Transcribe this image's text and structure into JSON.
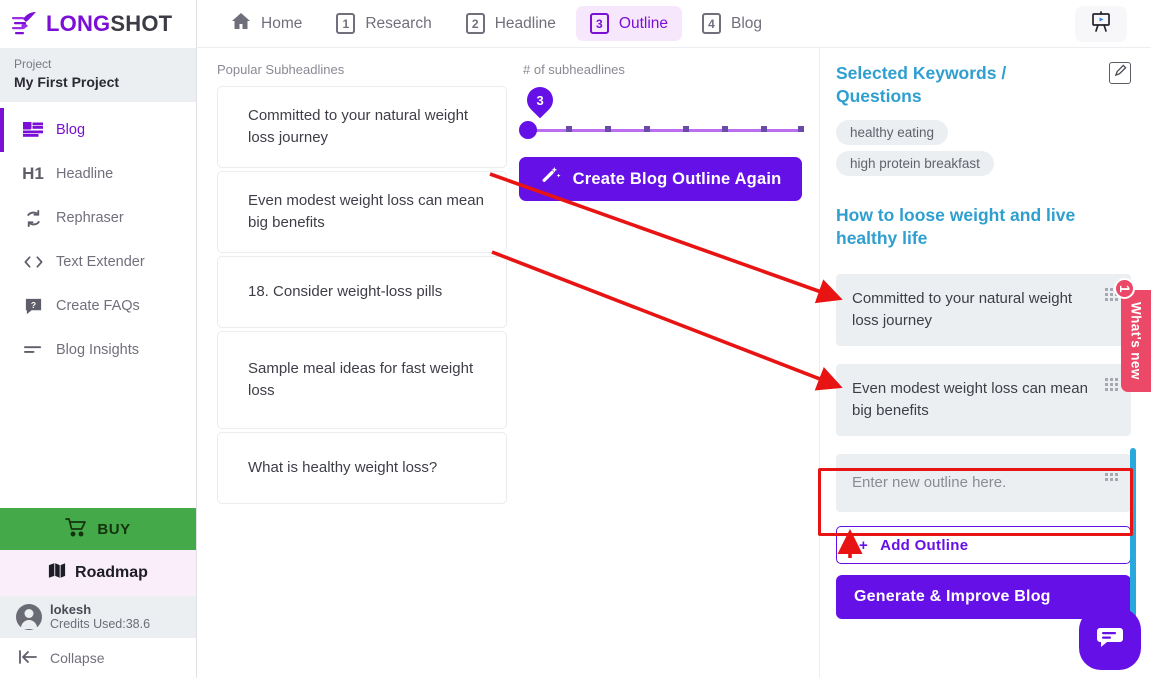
{
  "brand": {
    "logo_long": "LONG",
    "logo_shot": "SHOT",
    "logo_icon": "rocket-icon",
    "purple": "#7b0fd6",
    "accent_purple": "#6610e8",
    "teal": "#2f9fd0",
    "pink": "#ec4868",
    "green": "#44a948"
  },
  "sidebar": {
    "project_label": "Project",
    "project_name": "My First Project",
    "items": [
      {
        "label": "Blog",
        "icon": "blog-icon",
        "active": true
      },
      {
        "label": "Headline",
        "icon": "h1-icon",
        "active": false
      },
      {
        "label": "Rephraser",
        "icon": "refresh-icon",
        "active": false
      },
      {
        "label": "Text Extender",
        "icon": "code-brackets-icon",
        "active": false
      },
      {
        "label": "Create FAQs",
        "icon": "chat-question-icon",
        "active": false
      },
      {
        "label": "Blog Insights",
        "icon": "lines-icon",
        "active": false
      }
    ],
    "buy_label": "BUY",
    "roadmap_label": "Roadmap",
    "user_name": "lokesh",
    "user_credits": "Credits Used:38.6",
    "collapse_label": "Collapse"
  },
  "topnav": {
    "tabs": [
      {
        "num": "",
        "label": "Home",
        "icon": "home-icon",
        "active": false
      },
      {
        "num": "1",
        "label": "Research",
        "active": false
      },
      {
        "num": "2",
        "label": "Headline",
        "active": false
      },
      {
        "num": "3",
        "label": "Outline",
        "active": true
      },
      {
        "num": "4",
        "label": "Blog",
        "active": false
      }
    ],
    "tutorial_icon": "presentation-board-icon"
  },
  "subheadlines": {
    "section_label": "Popular Subheadlines",
    "cards": [
      "Committed to your natural weight loss journey",
      "Even modest weight loss can mean big benefits",
      "18. Consider weight-loss pills",
      "Sample meal ideas for fast weight loss",
      "What is healthy weight loss?"
    ]
  },
  "slider": {
    "label": "# of subheadlines",
    "value": "3",
    "min": 3,
    "max": 10,
    "ticks": 7
  },
  "create_button": {
    "label": "Create Blog Outline Again",
    "icon": "magic-wand-icon"
  },
  "right_panel": {
    "title": "Selected Keywords / Questions",
    "edit_icon": "edit-pencil-icon",
    "keywords": [
      "healthy eating",
      "high protein breakfast"
    ],
    "headline": "How to loose weight and live healthy life",
    "outline_items": [
      {
        "text": "Committed to your natural weight loss journey",
        "placeholder": false
      },
      {
        "text": "Even modest weight loss can mean big benefits",
        "placeholder": false
      },
      {
        "text": "Enter new outline here.",
        "placeholder": true
      }
    ],
    "add_outline_label": "Add Outline",
    "add_outline_plus": "+",
    "generate_label": "Generate & Improve Blog"
  },
  "overlays": {
    "whats_new_label": "What's new",
    "whats_new_badge": "1",
    "chat_icon": "chat-bubble-icon"
  }
}
